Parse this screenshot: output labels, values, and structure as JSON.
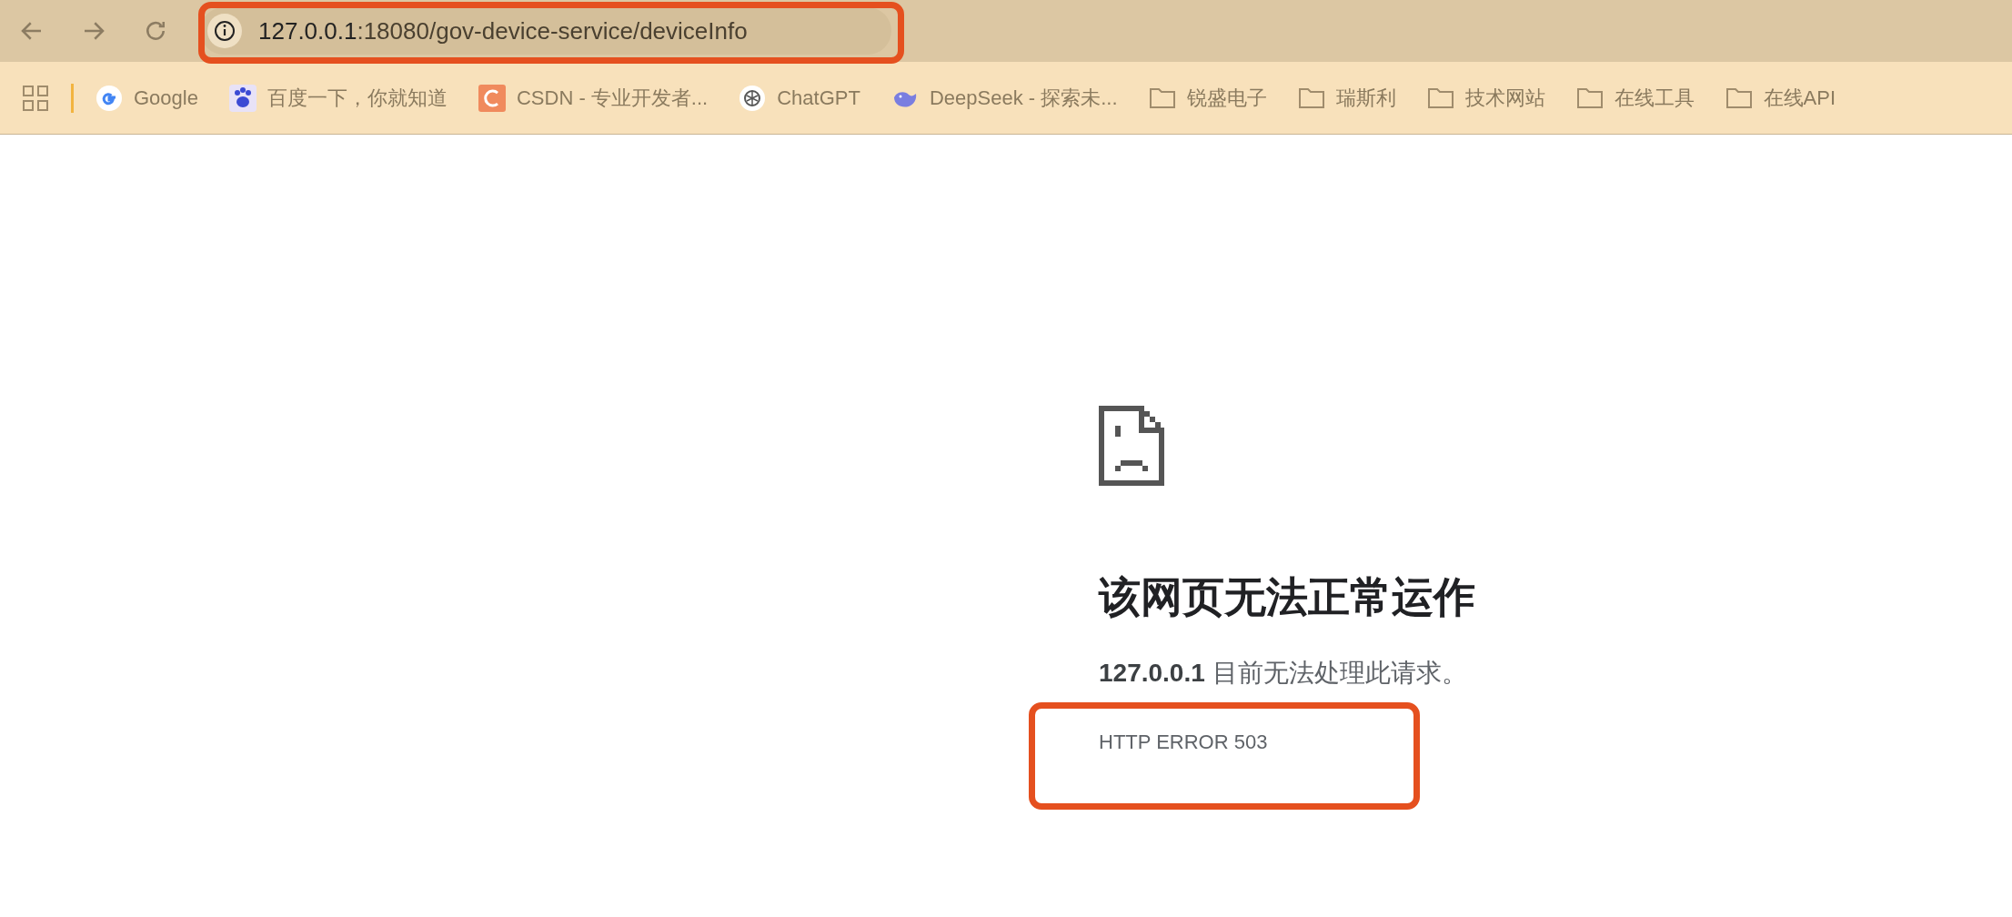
{
  "toolbar": {
    "url_host": "127.0.0.1",
    "url_path": ":18080/gov-device-service/deviceInfo"
  },
  "bookmarks": [
    {
      "kind": "link",
      "label": "Google"
    },
    {
      "kind": "link",
      "label": "百度一下，你就知道"
    },
    {
      "kind": "link",
      "label": "CSDN - 专业开发者..."
    },
    {
      "kind": "link",
      "label": "ChatGPT"
    },
    {
      "kind": "link",
      "label": "DeepSeek - 探索未..."
    },
    {
      "kind": "folder",
      "label": "锐盛电子"
    },
    {
      "kind": "folder",
      "label": "瑞斯利"
    },
    {
      "kind": "folder",
      "label": "技术网站"
    },
    {
      "kind": "folder",
      "label": "在线工具"
    },
    {
      "kind": "folder",
      "label": "在线API"
    }
  ],
  "error_page": {
    "title": "该网页无法正常运作",
    "description": "**127.0.0.1** 目前无法处理此请求。",
    "error_code": "HTTP ERROR 503"
  }
}
